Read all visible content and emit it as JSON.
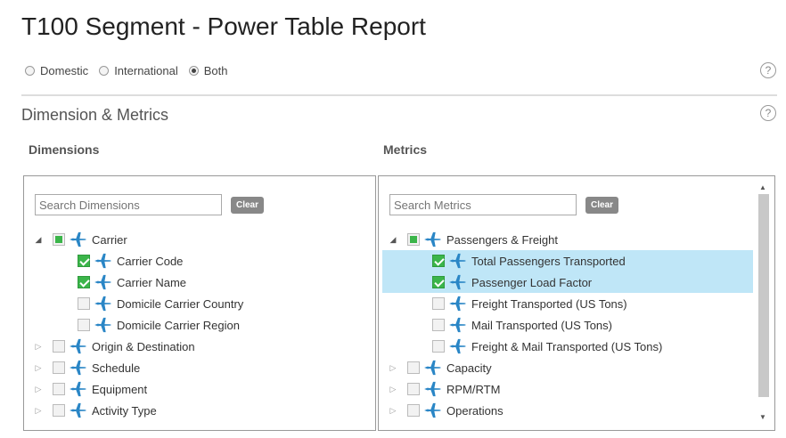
{
  "title": "T100 Segment - Power Table Report",
  "scope": {
    "options": [
      {
        "label": "Domestic",
        "checked": false
      },
      {
        "label": "International",
        "checked": false
      },
      {
        "label": "Both",
        "checked": true
      }
    ]
  },
  "help_glyph": "?",
  "section_title": "Dimension & Metrics",
  "dimensions": {
    "label": "Dimensions",
    "search_placeholder": "Search Dimensions",
    "clear_label": "Clear",
    "tree": [
      {
        "label": "Carrier",
        "level": 0,
        "expander": "expanded",
        "check": "partial",
        "icon": "plane-icon"
      },
      {
        "label": "Carrier Code",
        "level": 1,
        "check": "checked",
        "icon": "plane-icon"
      },
      {
        "label": "Carrier Name",
        "level": 1,
        "check": "checked",
        "icon": "plane-icon"
      },
      {
        "label": "Domicile Carrier Country",
        "level": 1,
        "check": "unchecked",
        "icon": "plane-icon"
      },
      {
        "label": "Domicile Carrier Region",
        "level": 1,
        "check": "unchecked",
        "icon": "plane-icon"
      },
      {
        "label": "Origin & Destination",
        "level": 0,
        "expander": "collapsed",
        "check": "unchecked",
        "icon": "plane-icon"
      },
      {
        "label": "Schedule",
        "level": 0,
        "expander": "collapsed",
        "check": "unchecked",
        "icon": "plane-icon"
      },
      {
        "label": "Equipment",
        "level": 0,
        "expander": "collapsed",
        "check": "unchecked",
        "icon": "plane-icon"
      },
      {
        "label": "Activity Type",
        "level": 0,
        "expander": "collapsed",
        "check": "unchecked",
        "icon": "plane-icon"
      }
    ]
  },
  "metrics": {
    "label": "Metrics",
    "search_placeholder": "Search Metrics",
    "clear_label": "Clear",
    "tree": [
      {
        "label": "Passengers & Freight",
        "level": 0,
        "expander": "expanded",
        "check": "partial",
        "icon": "plane-icon"
      },
      {
        "label": "Total Passengers Transported",
        "level": 1,
        "check": "checked",
        "selected": true,
        "icon": "plane-icon"
      },
      {
        "label": "Passenger Load Factor",
        "level": 1,
        "check": "checked",
        "selected": true,
        "icon": "plane-icon"
      },
      {
        "label": "Freight Transported (US Tons)",
        "level": 1,
        "check": "unchecked",
        "icon": "plane-icon"
      },
      {
        "label": "Mail Transported (US Tons)",
        "level": 1,
        "check": "unchecked",
        "icon": "plane-icon"
      },
      {
        "label": "Freight & Mail Transported (US Tons)",
        "level": 1,
        "check": "unchecked",
        "icon": "plane-icon"
      },
      {
        "label": "Capacity",
        "level": 0,
        "expander": "collapsed",
        "check": "unchecked",
        "icon": "plane-icon"
      },
      {
        "label": "RPM/RTM",
        "level": 0,
        "expander": "collapsed",
        "check": "unchecked",
        "icon": "plane-icon"
      },
      {
        "label": "Operations",
        "level": 0,
        "expander": "collapsed",
        "check": "unchecked",
        "icon": "plane-icon"
      }
    ]
  },
  "colors": {
    "plane": "#2a86c6",
    "selected_row": "#bfe6f7",
    "check_green": "#3bb54a"
  }
}
